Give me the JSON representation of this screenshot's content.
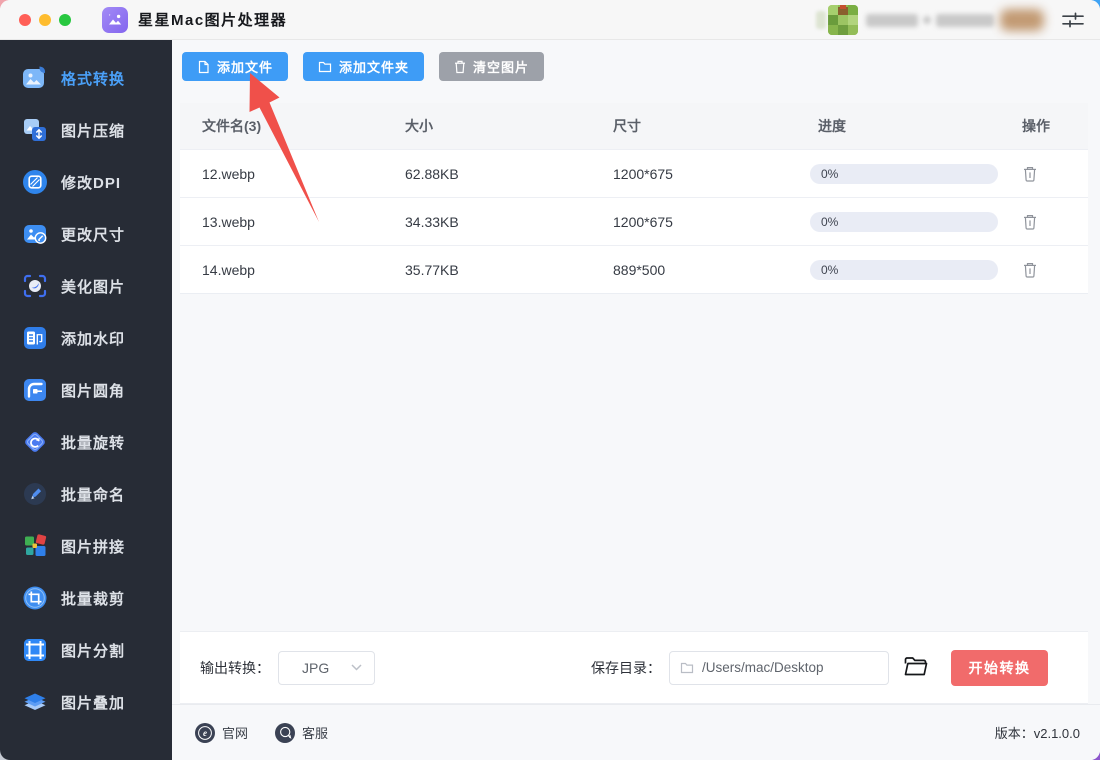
{
  "colors": {
    "primary": "#3e9cf6",
    "accent": "#4aa0f8",
    "info_gray": "#9da1a9",
    "danger": "#f16b6b",
    "sidebar_bg": "#272c36",
    "main_bg": "#f7f8fa",
    "progress_track": "#e9ecf5",
    "arrow_red": "#f0504a"
  },
  "topbar": {
    "title": "星星Mac图片处理器"
  },
  "sidebar": {
    "items": [
      {
        "label": "格式转换",
        "icon": "format-convert-icon",
        "selected": true
      },
      {
        "label": "图片压缩",
        "icon": "image-compress-icon",
        "selected": false
      },
      {
        "label": "修改DPI",
        "icon": "modify-dpi-icon",
        "selected": false
      },
      {
        "label": "更改尺寸",
        "icon": "resize-icon",
        "selected": false
      },
      {
        "label": "美化图片",
        "icon": "beautify-icon",
        "selected": false
      },
      {
        "label": "添加水印",
        "icon": "watermark-icon",
        "selected": false
      },
      {
        "label": "图片圆角",
        "icon": "round-corner-icon",
        "selected": false
      },
      {
        "label": "批量旋转",
        "icon": "batch-rotate-icon",
        "selected": false
      },
      {
        "label": "批量命名",
        "icon": "batch-rename-icon",
        "selected": false
      },
      {
        "label": "图片拼接",
        "icon": "image-stitch-icon",
        "selected": false
      },
      {
        "label": "批量裁剪",
        "icon": "batch-crop-icon",
        "selected": false
      },
      {
        "label": "图片分割",
        "icon": "image-split-icon",
        "selected": false
      },
      {
        "label": "图片叠加",
        "icon": "image-overlay-icon",
        "selected": false
      }
    ]
  },
  "toolbar": {
    "add_file": "添加文件",
    "add_folder": "添加文件夹",
    "clear": "清空图片"
  },
  "table": {
    "headers": {
      "name": "文件名(3)",
      "size": "大小",
      "dims": "尺寸",
      "progress": "进度",
      "actions": "操作"
    },
    "rows": [
      {
        "name": "12.webp",
        "size": "62.88KB",
        "dims": "1200*675",
        "progress": "0%"
      },
      {
        "name": "13.webp",
        "size": "34.33KB",
        "dims": "1200*675",
        "progress": "0%"
      },
      {
        "name": "14.webp",
        "size": "35.77KB",
        "dims": "889*500",
        "progress": "0%"
      }
    ]
  },
  "convert_bar": {
    "output_label": "输出转换：",
    "format_value": "JPG",
    "save_label": "保存目录：",
    "save_path": "/Users/mac/Desktop",
    "start_button": "开始转换"
  },
  "footer": {
    "website": "官网",
    "support": "客服",
    "version_label": "版本：",
    "version": "v2.1.0.0"
  }
}
